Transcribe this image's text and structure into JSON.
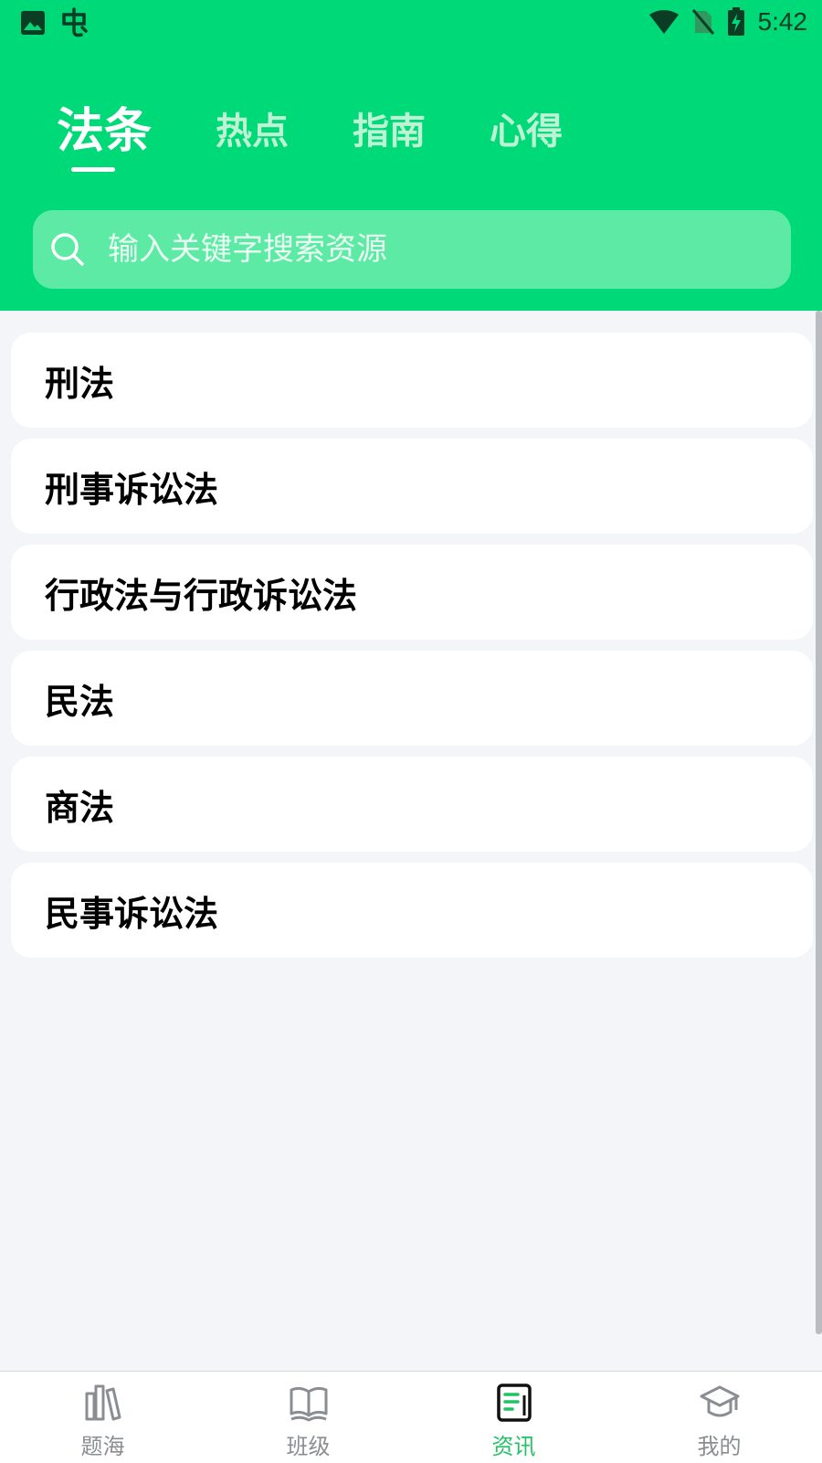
{
  "status_bar": {
    "time": "5:42",
    "left_icons": [
      "image-icon",
      "bug-icon"
    ],
    "right_icons": [
      "wifi-icon",
      "no-sim-icon",
      "battery-charging-icon"
    ]
  },
  "tabs": [
    {
      "label": "法条",
      "active": true
    },
    {
      "label": "热点",
      "active": false
    },
    {
      "label": "指南",
      "active": false
    },
    {
      "label": "心得",
      "active": false
    }
  ],
  "search": {
    "placeholder": "输入关键字搜索资源",
    "value": ""
  },
  "categories": [
    {
      "label": "刑法"
    },
    {
      "label": "刑事诉讼法"
    },
    {
      "label": "行政法与行政诉讼法"
    },
    {
      "label": "民法"
    },
    {
      "label": "商法"
    },
    {
      "label": "民事诉讼法"
    }
  ],
  "bottom_nav": [
    {
      "label": "题海",
      "icon": "books-icon",
      "active": false
    },
    {
      "label": "班级",
      "icon": "open-book-icon",
      "active": false
    },
    {
      "label": "资讯",
      "icon": "news-icon",
      "active": true
    },
    {
      "label": "我的",
      "icon": "graduation-cap-icon",
      "active": false
    }
  ],
  "colors": {
    "brand_green": "#00d978",
    "active_nav": "#21c265",
    "inactive_nav": "#8a8d92",
    "page_background": "#f3f5f8"
  }
}
